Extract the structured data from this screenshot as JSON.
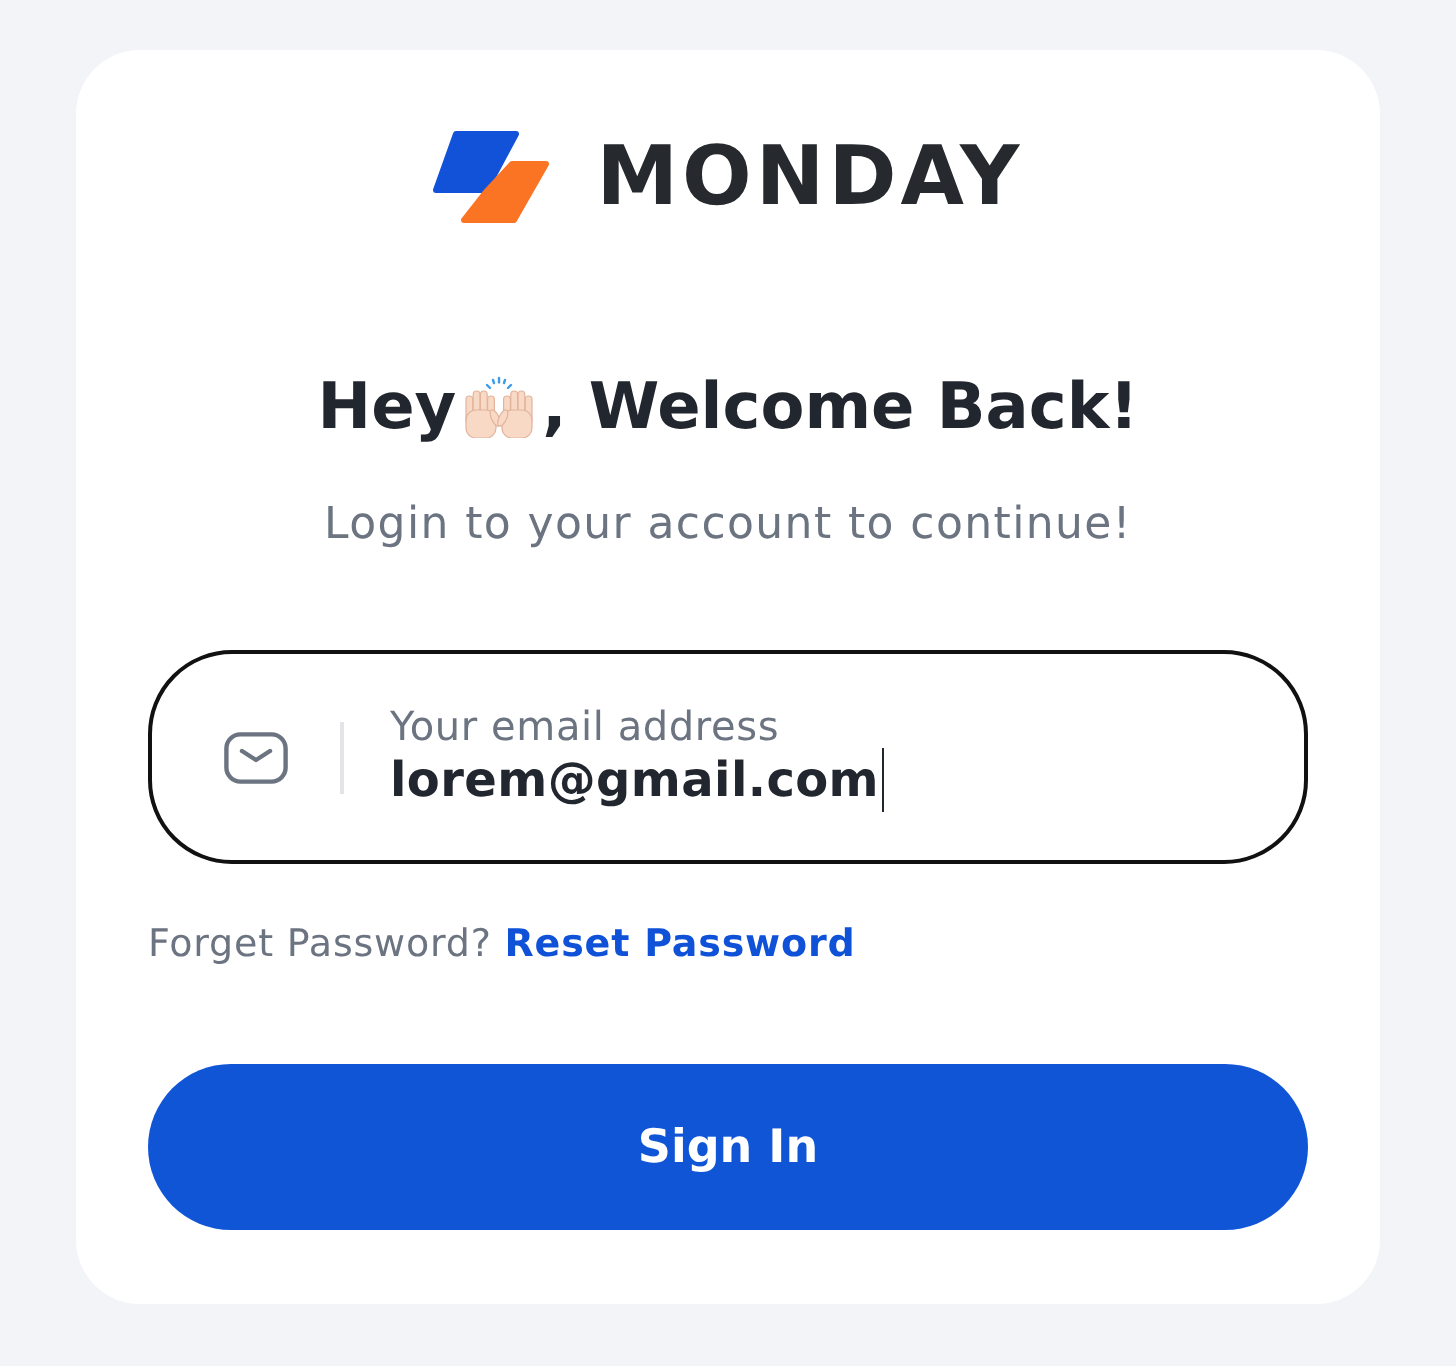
{
  "logo": {
    "wordmark": "MONDAY"
  },
  "heading": {
    "before_icon": "Hey",
    "after_icon": ", Welcome Back!"
  },
  "subtitle": "Login to your account to continue!",
  "email_field": {
    "label": "Your email address",
    "value": "lorem@gmail.com",
    "focused": true
  },
  "password_hint": {
    "text": "Forget Password?",
    "link": "Reset Password"
  },
  "sign_in_button": {
    "label": "Sign In"
  }
}
